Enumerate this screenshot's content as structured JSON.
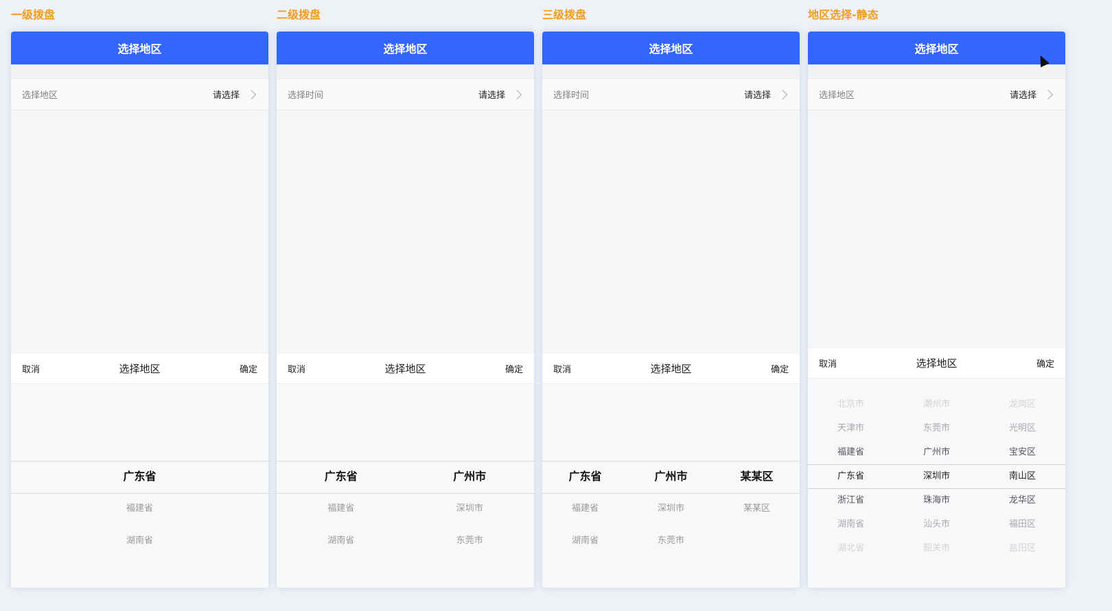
{
  "panels": [
    {
      "title": "一级拨盘",
      "header": "选择地区",
      "row_label": "选择地区",
      "row_value": "请选择",
      "sheet": {
        "cancel": "取消",
        "title": "选择地区",
        "confirm": "确定"
      },
      "columns": [
        {
          "selected": "广东省",
          "items": [
            "福建省",
            "湖南省"
          ]
        }
      ]
    },
    {
      "title": "二级拨盘",
      "header": "选择地区",
      "row_label": "选择时间",
      "row_value": "请选择",
      "sheet": {
        "cancel": "取消",
        "title": "选择地区",
        "confirm": "确定"
      },
      "columns": [
        {
          "selected": "广东省",
          "items": [
            "福建省",
            "湖南省"
          ]
        },
        {
          "selected": "广州市",
          "items": [
            "深圳市",
            "东莞市"
          ]
        }
      ]
    },
    {
      "title": "三级拨盘",
      "header": "选择地区",
      "row_label": "选择时间",
      "row_value": "请选择",
      "sheet": {
        "cancel": "取消",
        "title": "选择地区",
        "confirm": "确定"
      },
      "columns": [
        {
          "selected": "广东省",
          "items": [
            "福建省",
            "湖南省"
          ]
        },
        {
          "selected": "广州市",
          "items": [
            "深圳市",
            "东莞市"
          ]
        },
        {
          "selected": "某某区",
          "items": [
            "某某区"
          ]
        }
      ]
    }
  ],
  "static_panel": {
    "title": "地区选择-静态",
    "header": "选择地区",
    "row_label": "选择地区",
    "row_value": "请选择",
    "sheet": {
      "cancel": "取消",
      "title": "选择地区",
      "confirm": "确定"
    },
    "columns": [
      [
        "北京市",
        "天津市",
        "福建省",
        "广东省",
        "浙江省",
        "湖南省",
        "湖北省"
      ],
      [
        "潮州市",
        "东莞市",
        "广州市",
        "深圳市",
        "珠海市",
        "汕头市",
        "韶关市"
      ],
      [
        "龙岗区",
        "光明区",
        "宝安区",
        "南山区",
        "龙华区",
        "福田区",
        "盐田区"
      ]
    ]
  }
}
